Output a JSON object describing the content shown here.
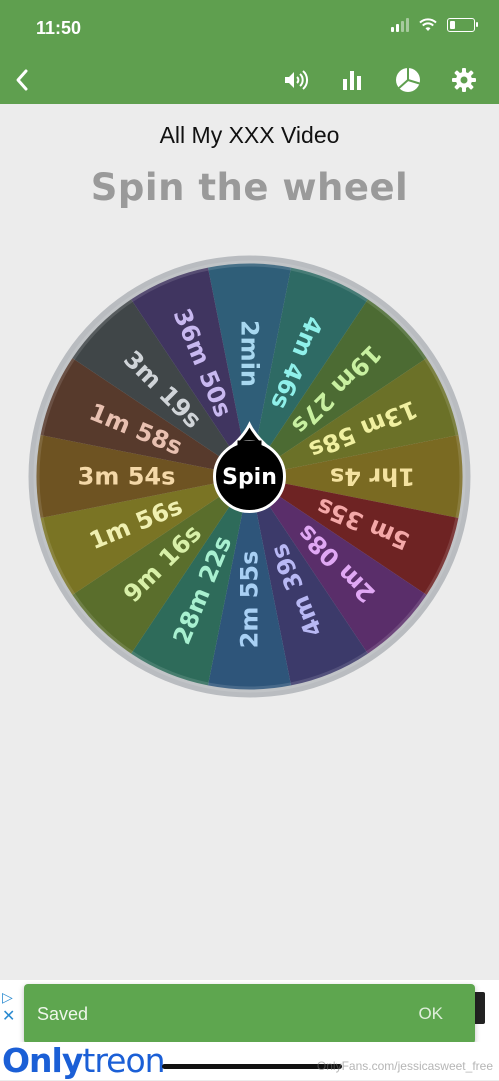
{
  "status": {
    "time": "11:50"
  },
  "toolbar": {
    "back_icon": "chevron-left-icon",
    "actions": [
      "volume-icon",
      "stats-icon",
      "pie-chart-icon",
      "gear-icon"
    ]
  },
  "wheel": {
    "title": "All My XXX Video",
    "heading": "Spin the wheel",
    "spin_label": "Spin",
    "segments": [
      {
        "label": "2min",
        "color": "#2f5e78"
      },
      {
        "label": "4m 46s",
        "color": "#2e6a64"
      },
      {
        "label": "19m 27s",
        "color": "#4c6b33"
      },
      {
        "label": "13m 58s",
        "color": "#6b7128"
      },
      {
        "label": "1hr 4s",
        "color": "#7a6a22"
      },
      {
        "label": "5m 35s",
        "color": "#6e2323"
      },
      {
        "label": "2m 08s",
        "color": "#5a2e6a"
      },
      {
        "label": "4m 39s",
        "color": "#3c3a6a"
      },
      {
        "label": "2m 55s",
        "color": "#2e557a"
      },
      {
        "label": "28m 22s",
        "color": "#2e6b5a"
      },
      {
        "label": "9m 16s",
        "color": "#5a6e2c"
      },
      {
        "label": "1m 56s",
        "color": "#7a7424"
      },
      {
        "label": "3m 54s",
        "color": "#6e5322"
      },
      {
        "label": "1m 58s",
        "color": "#573a2c"
      },
      {
        "label": "3m 19s",
        "color": "#404648"
      },
      {
        "label": "36m 50s",
        "color": "#403560"
      }
    ]
  },
  "snackbar": {
    "message": "Saved",
    "action": "OK"
  },
  "watermark": {
    "brand_a": "Only",
    "brand_b": "treon",
    "url": "OnlyFans.com/jessicasweet_free"
  }
}
